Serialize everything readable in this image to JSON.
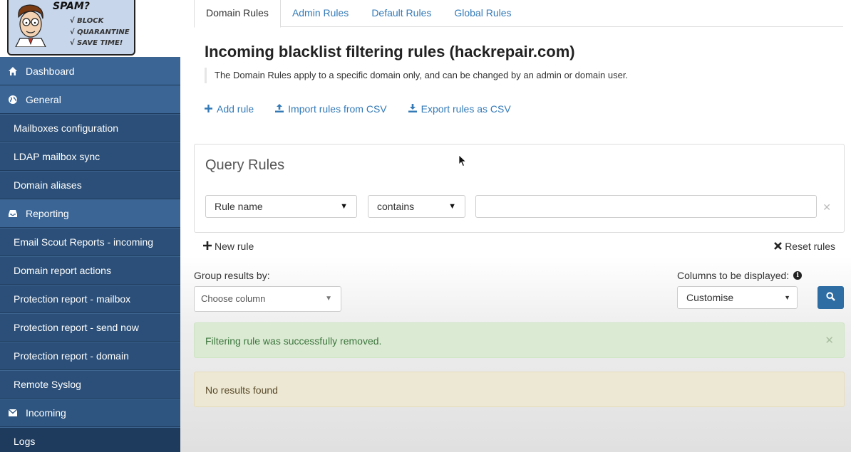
{
  "logo": {
    "title": "SPAM?",
    "lines": [
      "√ BLOCK",
      "√ QUARANTINE",
      "√ SAVE TIME!"
    ]
  },
  "sidebar": {
    "items": [
      {
        "label": "Dashboard",
        "icon": "home-icon",
        "type": "section"
      },
      {
        "label": "General",
        "icon": "globe-icon",
        "type": "section"
      },
      {
        "label": "Mailboxes configuration",
        "type": "sub"
      },
      {
        "label": "LDAP mailbox sync",
        "type": "sub"
      },
      {
        "label": "Domain aliases",
        "type": "sub"
      },
      {
        "label": "Reporting",
        "icon": "inbox-icon",
        "type": "section"
      },
      {
        "label": "Email Scout Reports - incoming",
        "type": "sub"
      },
      {
        "label": "Domain report actions",
        "type": "sub"
      },
      {
        "label": "Protection report - mailbox",
        "type": "sub"
      },
      {
        "label": "Protection report - send now",
        "type": "sub"
      },
      {
        "label": "Protection report - domain",
        "type": "sub"
      },
      {
        "label": "Remote Syslog",
        "type": "sub"
      },
      {
        "label": "Incoming",
        "icon": "envelope-icon",
        "type": "section"
      },
      {
        "label": "Logs",
        "type": "sub"
      }
    ]
  },
  "tabs": [
    {
      "label": "Domain Rules",
      "active": true
    },
    {
      "label": "Admin Rules",
      "active": false
    },
    {
      "label": "Default Rules",
      "active": false
    },
    {
      "label": "Global Rules",
      "active": false
    }
  ],
  "page": {
    "title": "Incoming blacklist filtering rules (hackrepair.com)",
    "description": "The Domain Rules apply to a specific domain only, and can be changed by an admin or domain user."
  },
  "actions": {
    "add_rule": "Add rule",
    "import_csv": "Import rules from CSV",
    "export_csv": "Export rules as CSV"
  },
  "query": {
    "title": "Query Rules",
    "field": "Rule name",
    "operator": "contains",
    "value": "",
    "new_rule": "New rule",
    "reset_rules": "Reset rules"
  },
  "group": {
    "label": "Group results by:",
    "placeholder": "Choose column"
  },
  "columns": {
    "label": "Columns to be displayed:",
    "value": "Customise"
  },
  "alerts": {
    "success": "Filtering rule was successfully removed.",
    "empty": "No results found"
  },
  "colors": {
    "sidebar": "#2a4d74",
    "link": "#337ab7",
    "success_bg": "#dbead3",
    "warning_bg": "#ede8d3",
    "search_button": "#2e6da4"
  }
}
